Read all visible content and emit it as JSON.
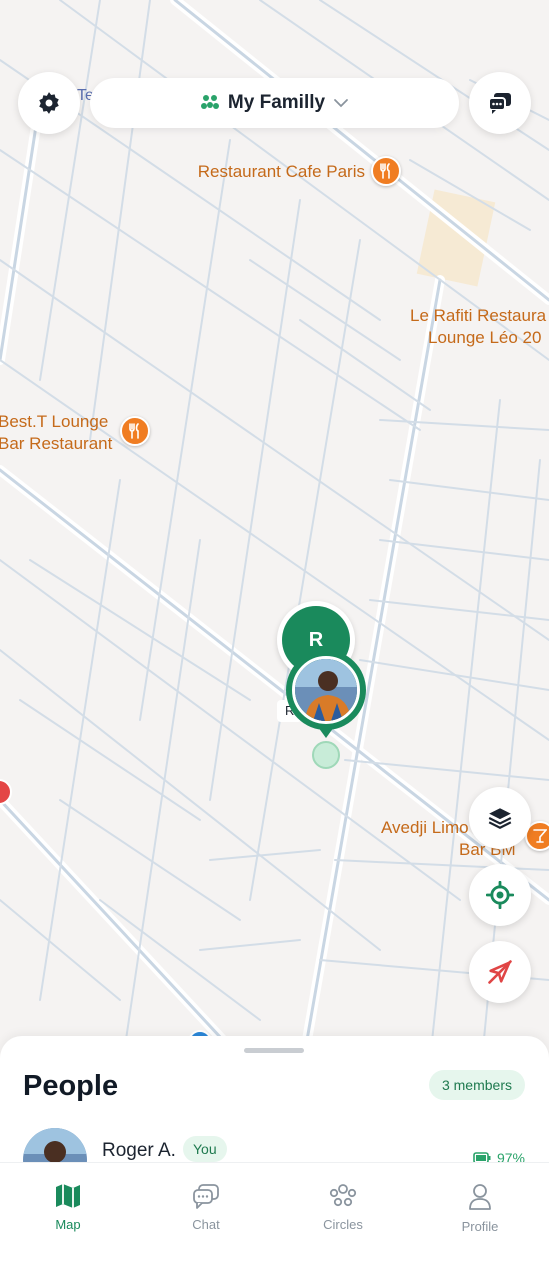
{
  "header": {
    "circle_name": "My Familly"
  },
  "map": {
    "pois": [
      {
        "name": "Restaurant Cafe Paris",
        "icon": "restaurant-icon"
      },
      {
        "name_line1": "Le Rafiti Restaura",
        "name_line2": "Lounge Léo 20",
        "icon": "restaurant-icon"
      },
      {
        "name_line1": "Best.T Lounge",
        "name_line2": "Bar Restaurant",
        "icon": "restaurant-icon"
      },
      {
        "name_line1": "Avedji Limo",
        "name_line2": "Bar BM",
        "icon": "bar-icon"
      }
    ],
    "partial_label": "Tel",
    "markers": [
      {
        "initial": "R",
        "color": "#1a8a5c"
      },
      {
        "type": "photo",
        "color": "#1a8a5c",
        "tag": "R"
      }
    ]
  },
  "map_controls": {
    "layers_icon": "layers-icon",
    "locate_icon": "locate-icon",
    "location_off_icon": "location-off-icon"
  },
  "people_sheet": {
    "title": "People",
    "members_count": "3 members",
    "people": [
      {
        "name": "Roger A.",
        "badge": "You",
        "battery": "97%"
      }
    ]
  },
  "nav": {
    "items": [
      {
        "label": "Map",
        "icon": "map-icon",
        "active": true
      },
      {
        "label": "Chat",
        "icon": "chat-icon"
      },
      {
        "label": "Circles",
        "icon": "circles-icon"
      },
      {
        "label": "Profile",
        "icon": "profile-icon"
      }
    ]
  },
  "colors": {
    "accent": "#1a8a5c",
    "poi": "#f07d22",
    "poi_text": "#c56a1a"
  }
}
